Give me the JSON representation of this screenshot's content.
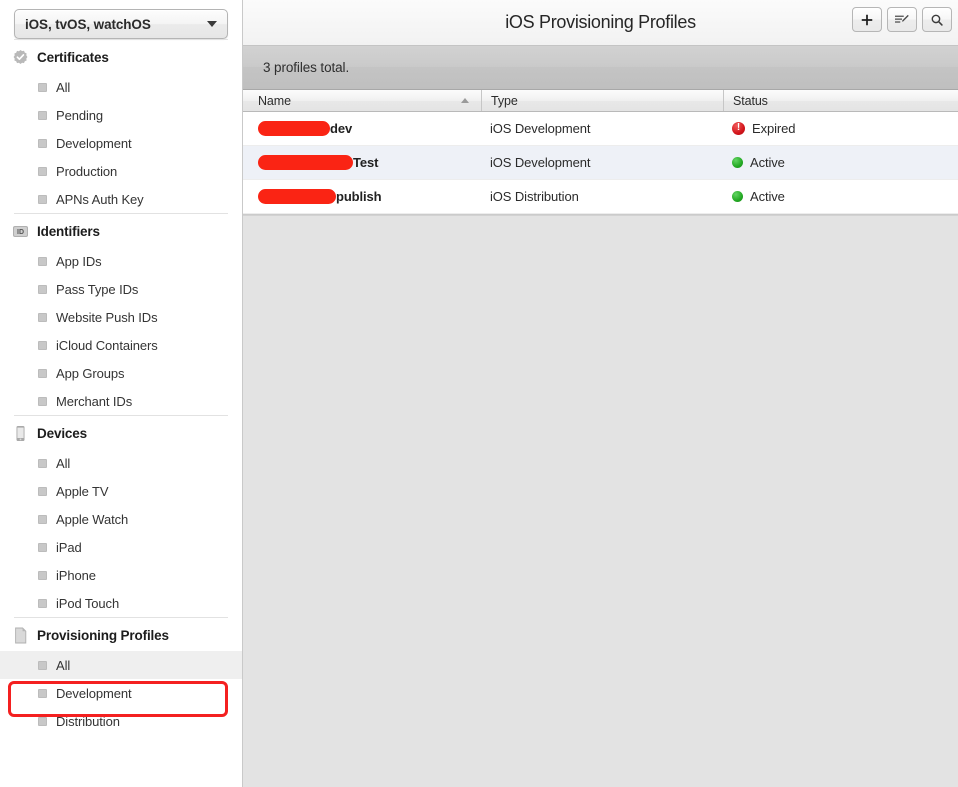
{
  "sidebar": {
    "team_select": {
      "value": "iOS, tvOS, watchOS",
      "caret_icon": "chevron-down-icon"
    },
    "groups": [
      {
        "id": "certificates",
        "icon": "certificate-seal-icon",
        "label": "Certificates",
        "items": [
          {
            "label": "All",
            "selected": false
          },
          {
            "label": "Pending",
            "selected": false
          },
          {
            "label": "Development",
            "selected": false
          },
          {
            "label": "Production",
            "selected": false
          },
          {
            "label": "APNs Auth Key",
            "selected": false
          }
        ]
      },
      {
        "id": "identifiers",
        "icon": "id-badge-icon",
        "label": "Identifiers",
        "items": [
          {
            "label": "App IDs",
            "selected": false
          },
          {
            "label": "Pass Type IDs",
            "selected": false
          },
          {
            "label": "Website Push IDs",
            "selected": false
          },
          {
            "label": "iCloud Containers",
            "selected": false
          },
          {
            "label": "App Groups",
            "selected": false
          },
          {
            "label": "Merchant IDs",
            "selected": false
          }
        ]
      },
      {
        "id": "devices",
        "icon": "device-phone-icon",
        "label": "Devices",
        "items": [
          {
            "label": "All",
            "selected": false
          },
          {
            "label": "Apple TV",
            "selected": false
          },
          {
            "label": "Apple Watch",
            "selected": false
          },
          {
            "label": "iPad",
            "selected": false
          },
          {
            "label": "iPhone",
            "selected": false
          },
          {
            "label": "iPod Touch",
            "selected": false
          }
        ]
      },
      {
        "id": "provisioning-profiles",
        "icon": "document-page-icon",
        "label": "Provisioning Profiles",
        "items": [
          {
            "label": "All",
            "selected": true
          },
          {
            "label": "Development",
            "selected": false
          },
          {
            "label": "Distribution",
            "selected": false
          }
        ]
      }
    ]
  },
  "main": {
    "title": "iOS Provisioning Profiles",
    "toolbar": {
      "add_icon": "plus-icon",
      "edit_icon": "edit-list-pencil-icon",
      "search_icon": "search-magnifier-icon"
    },
    "count_text": "3 profiles total.",
    "table": {
      "columns": [
        {
          "key": "name",
          "label": "Name",
          "sorted": "asc"
        },
        {
          "key": "type",
          "label": "Type",
          "sorted": ""
        },
        {
          "key": "status",
          "label": "Status",
          "sorted": ""
        }
      ],
      "rows": [
        {
          "name_redacted_width": 72,
          "name_suffix": "dev",
          "type": "iOS Development",
          "status": "Expired",
          "status_kind": "expired"
        },
        {
          "name_redacted_width": 95,
          "name_suffix": "Test",
          "type": "iOS Development",
          "status": "Active",
          "status_kind": "active"
        },
        {
          "name_redacted_width": 78,
          "name_suffix": "publish",
          "type": "iOS Distribution",
          "status": "Active",
          "status_kind": "active"
        }
      ]
    }
  },
  "annotations": {
    "highlight_color": "#f42020",
    "boxes": [
      {
        "target": "sidebar-item-all-provisioning"
      },
      {
        "target": "add-profile-button"
      }
    ]
  }
}
